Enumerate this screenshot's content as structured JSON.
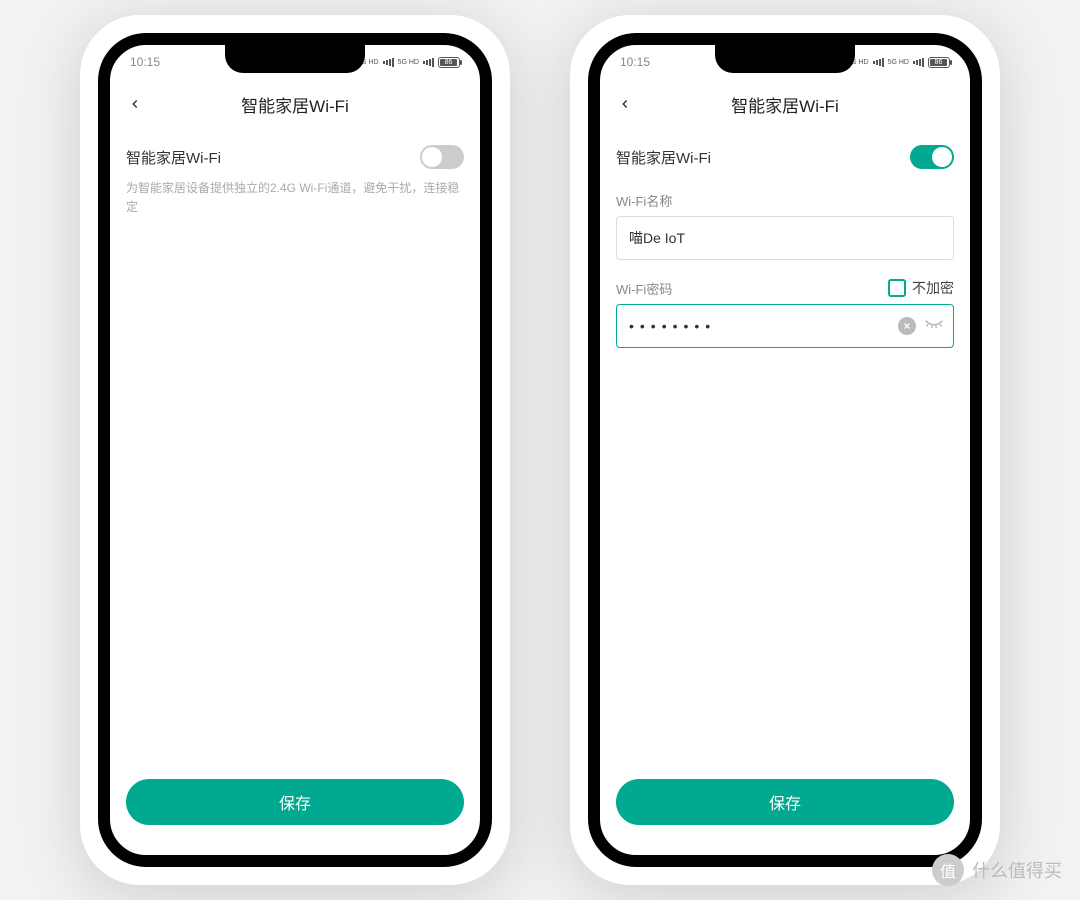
{
  "status": {
    "time": "10:15",
    "sg1": "5G HD",
    "sg2": "5G HD",
    "battery": "86"
  },
  "left": {
    "title": "智能家居Wi-Fi",
    "toggle_label": "智能家居Wi-Fi",
    "toggle_on": false,
    "description": "为智能家居设备提供独立的2.4G Wi-Fi通道，避免干扰，连接稳定",
    "save": "保存"
  },
  "right": {
    "title": "智能家居Wi-Fi",
    "toggle_label": "智能家居Wi-Fi",
    "toggle_on": true,
    "wifi_name_label": "Wi-Fi名称",
    "wifi_name_value": "喵De IoT",
    "wifi_pwd_label": "Wi-Fi密码",
    "no_encrypt_label": "不加密",
    "wifi_pwd_value": "••••••••",
    "save": "保存"
  },
  "watermark": {
    "badge": "值",
    "text": "什么值得买"
  }
}
